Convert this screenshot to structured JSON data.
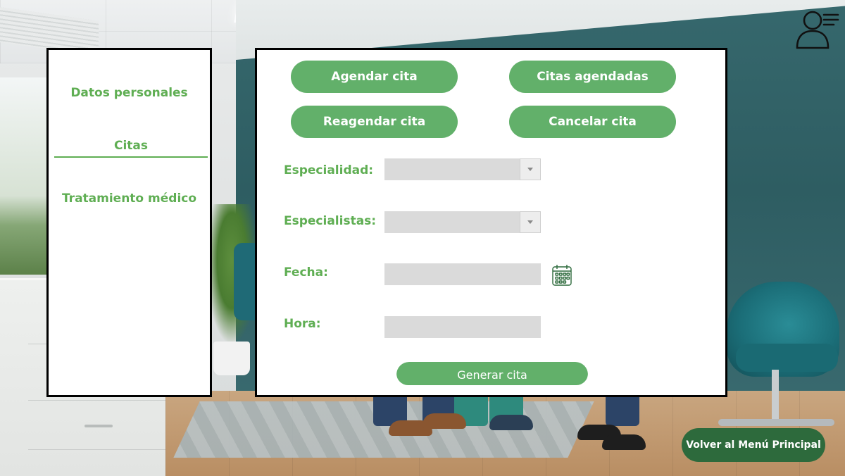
{
  "header": {
    "profile_icon": "user-menu-icon"
  },
  "sidebar": {
    "items": [
      {
        "label": "Datos personales",
        "active": false
      },
      {
        "label": "Citas",
        "active": true
      },
      {
        "label": "Tratamiento médico",
        "active": false
      }
    ]
  },
  "actions": {
    "schedule": "Agendar cita",
    "scheduled": "Citas agendadas",
    "reschedule": "Reagendar cita",
    "cancel": "Cancelar cita"
  },
  "form": {
    "specialty": {
      "label": "Especialidad:",
      "value": ""
    },
    "specialists": {
      "label": "Especialistas:",
      "value": ""
    },
    "date": {
      "label": "Fecha:",
      "value": "",
      "icon": "calendar-icon"
    },
    "time": {
      "label": "Hora:",
      "value": ""
    },
    "submit_label": "Generar cita"
  },
  "footer": {
    "back_label": "Volver al Menú Principal"
  },
  "colors": {
    "accent_green": "#62b06a",
    "label_green": "#5fae53",
    "dark_green": "#2d6a3c",
    "field_gray": "#dadada"
  }
}
